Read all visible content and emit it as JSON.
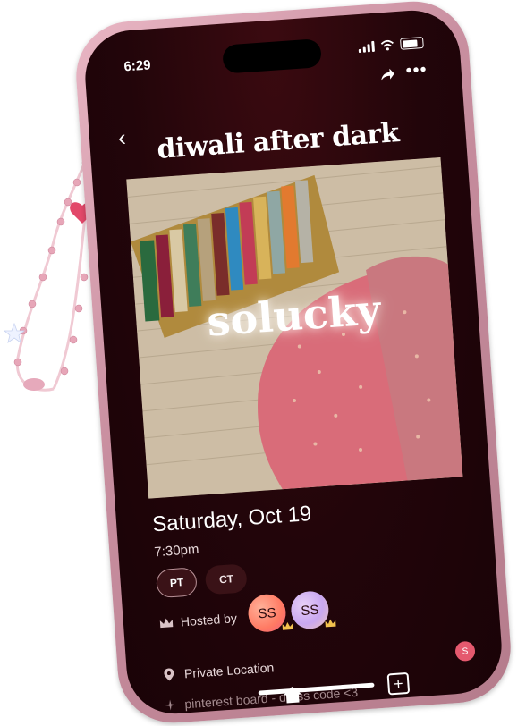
{
  "status_bar": {
    "time": "6:29"
  },
  "event": {
    "title": "diwali after dark",
    "cover_text": "solucky",
    "date": "Saturday, Oct 19",
    "time": "7:30pm",
    "timezones": [
      "PT",
      "CT"
    ],
    "hosted_by_label": "Hosted by",
    "hosts": [
      {
        "initials": "SS",
        "color_a": "#ff8a6b",
        "color_b": "#ffb199"
      },
      {
        "initials": "SS",
        "color_a": "#c9a7f0",
        "color_b": "#f0c7b7"
      }
    ],
    "location": "Private Location",
    "location_badge": "S",
    "extra_line": "pinterest board - dress code <3"
  },
  "colors": {
    "screen_bg": "#22050a",
    "accent_pink": "#e5596e",
    "frame": "#c88e9f"
  },
  "icons": {
    "back": "chevron-left-icon",
    "share": "share-icon",
    "more": "ellipsis-icon",
    "home": "home-icon",
    "add": "plus-square-icon",
    "crown": "crown-icon",
    "location": "location-pin-icon"
  }
}
